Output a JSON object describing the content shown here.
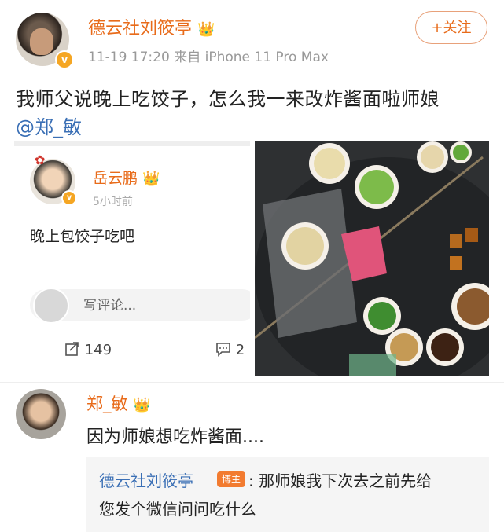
{
  "post": {
    "author": "德云社刘筱亭",
    "time": "11-19 17:20",
    "source": "来自 iPhone 11 Pro Max",
    "follow_label": "+关注",
    "text": "我师父说晚上吃饺子，怎么我一来改炸酱面啦师娘",
    "mention": "@郑_敏"
  },
  "embedded": {
    "author": "岳云鹏",
    "time": "5小时前",
    "text": "晚上包饺子吃吧",
    "comment_placeholder": "写评论...",
    "share_count": "149",
    "comment_count_partial": "2"
  },
  "reply": {
    "author": "郑_敏",
    "text": "因为师娘想吃炸酱面....",
    "sub": {
      "author": "德云社刘筱亭",
      "tag": "博主",
      "text_line1": ": 那师娘我下次去之前先给",
      "text_line2": "您发个微信问问吃什么"
    }
  },
  "icons": {
    "verified": "verified-badge-icon",
    "crown": "crown-icon",
    "share": "share-icon",
    "comment": "comment-icon"
  },
  "colors": {
    "accent": "#e86b1a",
    "link": "#3a6fb5",
    "verified": "#f5a623"
  }
}
